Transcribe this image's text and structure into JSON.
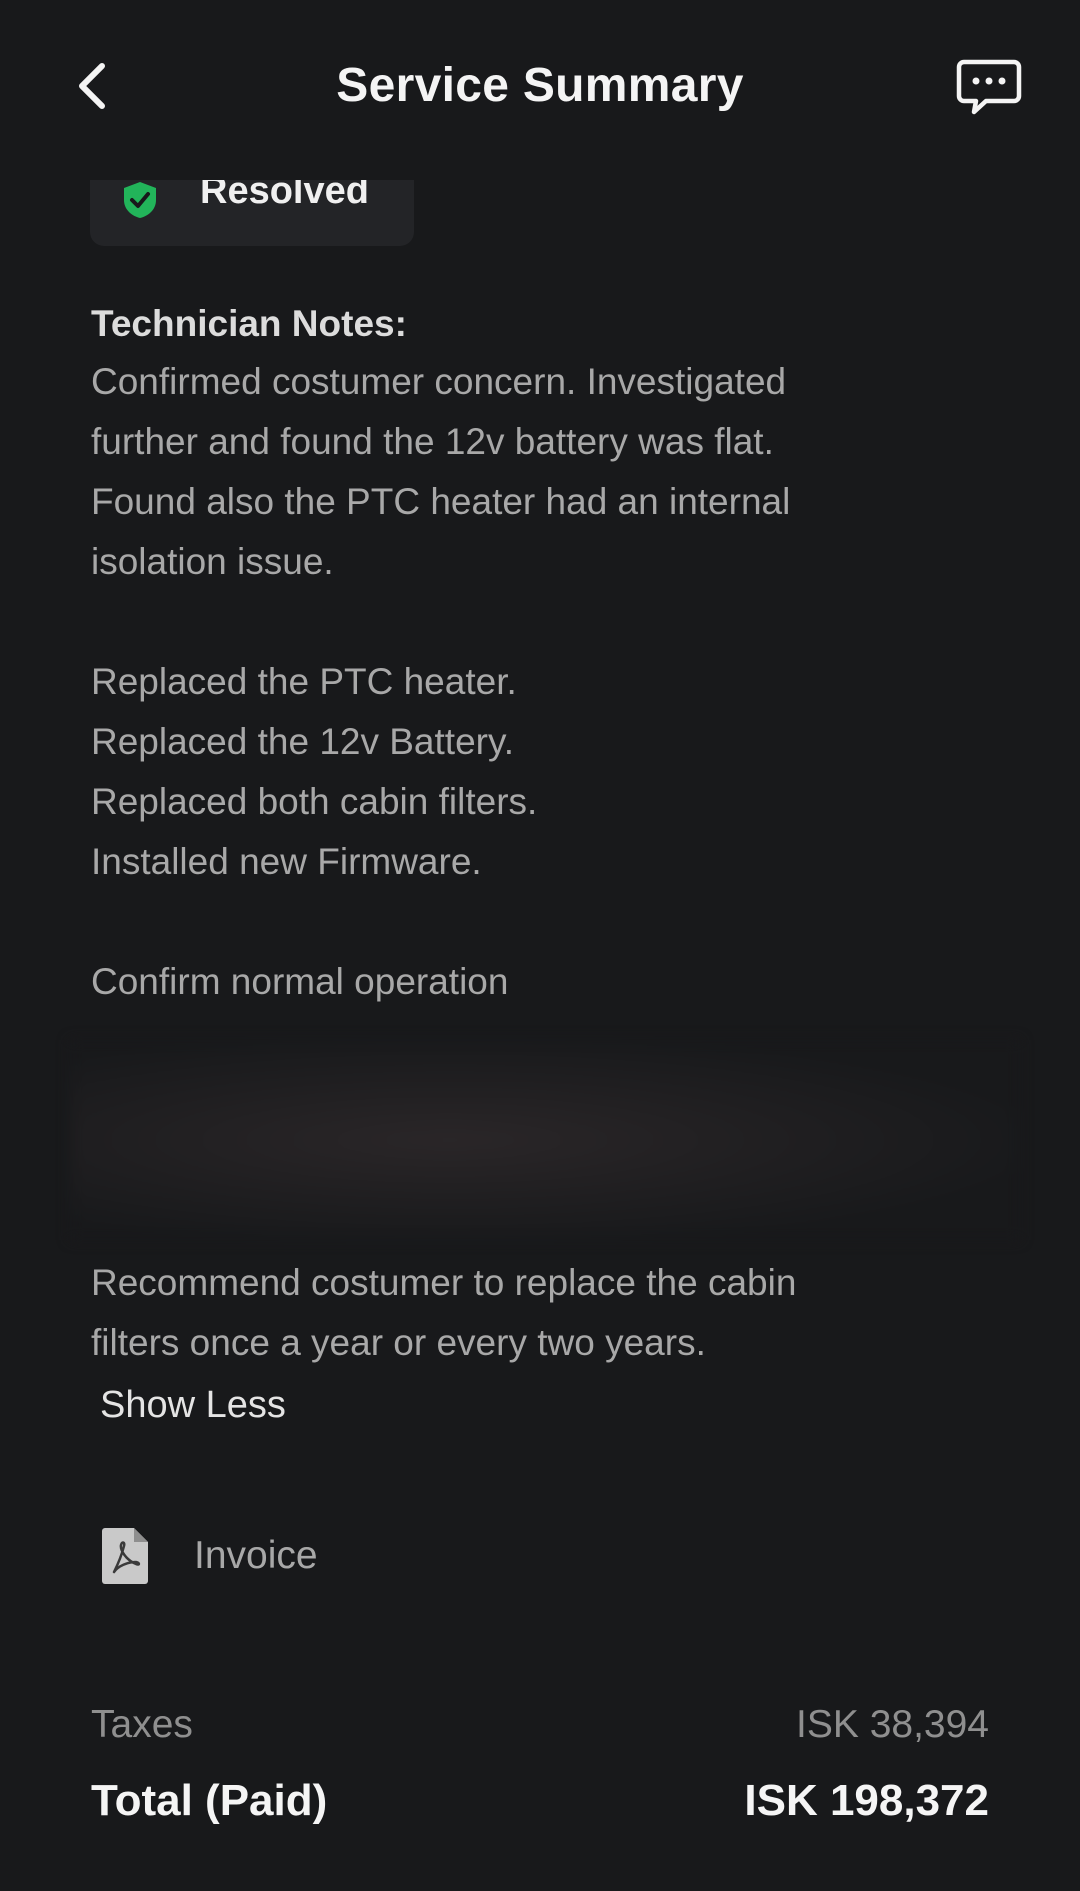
{
  "header": {
    "title": "Service Summary",
    "back_icon": "chevron-left-icon",
    "chat_icon": "chat-bubble-icon"
  },
  "status": {
    "label": "Resolved",
    "icon": "check-shield-icon",
    "icon_color": "#22b45a"
  },
  "notes": {
    "heading": "Technician Notes:",
    "paragraph1": [
      "Confirmed costumer concern. Investigated",
      "further and found the 12v battery was flat.",
      "Found also the PTC heater had an internal",
      "isolation issue."
    ],
    "paragraph2": [
      "Replaced the PTC heater.",
      "Replaced the 12v Battery.",
      "Replaced both cabin filters.",
      "Installed new Firmware."
    ],
    "paragraph3": "Confirm normal operation",
    "recommendation": [
      "Recommend costumer to replace the cabin",
      "filters once a year or every two years."
    ],
    "toggle_label": "Show Less"
  },
  "invoice": {
    "label": "Invoice",
    "icon": "pdf-file-icon"
  },
  "summary": {
    "taxes_label": "Taxes",
    "taxes_value": "ISK 38,394",
    "total_label": "Total (Paid)",
    "total_value": "ISK 198,372"
  },
  "colors": {
    "background": "#18191b",
    "pill": "#232427",
    "accent_green": "#22b45a"
  }
}
